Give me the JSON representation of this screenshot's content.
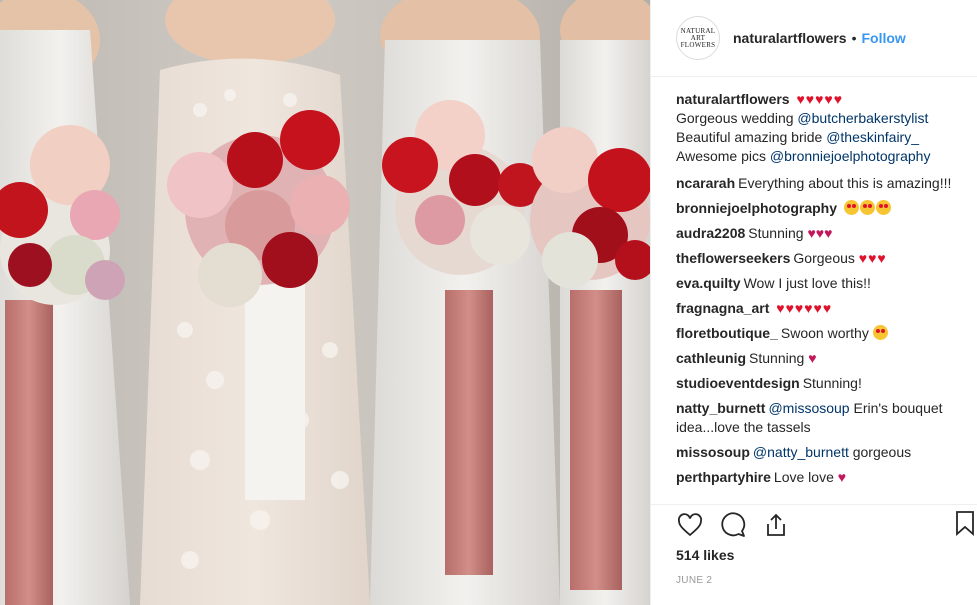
{
  "post": {
    "username": "naturalartflowers",
    "separator": "•",
    "follow_label": "Follow",
    "avatar_text": "NATURAL\nART\nFLOWERS"
  },
  "caption": {
    "username": "naturalartflowers",
    "hearts": "♥♥♥♥♥",
    "line1_text": "Gorgeous wedding ",
    "line1_mention": "@butcherbakerstylist",
    "line2_text": "Beautiful amazing bride ",
    "line2_mention": "@theskinfairy_",
    "line3_text": "Awesome pics ",
    "line3_mention": "@bronniejoelphotography"
  },
  "comments": [
    {
      "user": "ncararah",
      "text": "Everything about this is amazing!!!"
    },
    {
      "user": "bronniejoelphotography",
      "text": ""
    },
    {
      "user": "audra2208",
      "text": "Stunning"
    },
    {
      "user": "theflowerseekers",
      "text": "Gorgeous",
      "hearts": "♥♥♥"
    },
    {
      "user": "eva.quilty",
      "text": "Wow I just love this!!"
    },
    {
      "user": "fragnagna_art",
      "text": "",
      "hearts": "♥♥♥♥♥♥"
    },
    {
      "user": "floretboutique_",
      "text": "Swoon worthy"
    },
    {
      "user": "cathleunig",
      "text": "Stunning"
    },
    {
      "user": "studioeventdesign",
      "text": "Stunning!"
    },
    {
      "user": "natty_burnett",
      "mention": "@missosoup",
      "text": " Erin's bouquet idea...love the tassels"
    },
    {
      "user": "missosoup",
      "mention": "@natty_burnett",
      "text": " gorgeous"
    },
    {
      "user": "perthpartyhire",
      "text": "Love love"
    }
  ],
  "footer": {
    "likes": "514 likes",
    "date": "JUNE 2"
  },
  "icons": [
    "heart-icon",
    "comment-icon",
    "share-icon",
    "bookmark-icon"
  ],
  "colors": {
    "accent": "#3897f0",
    "mention": "#003569",
    "heart": "#e0112b"
  }
}
